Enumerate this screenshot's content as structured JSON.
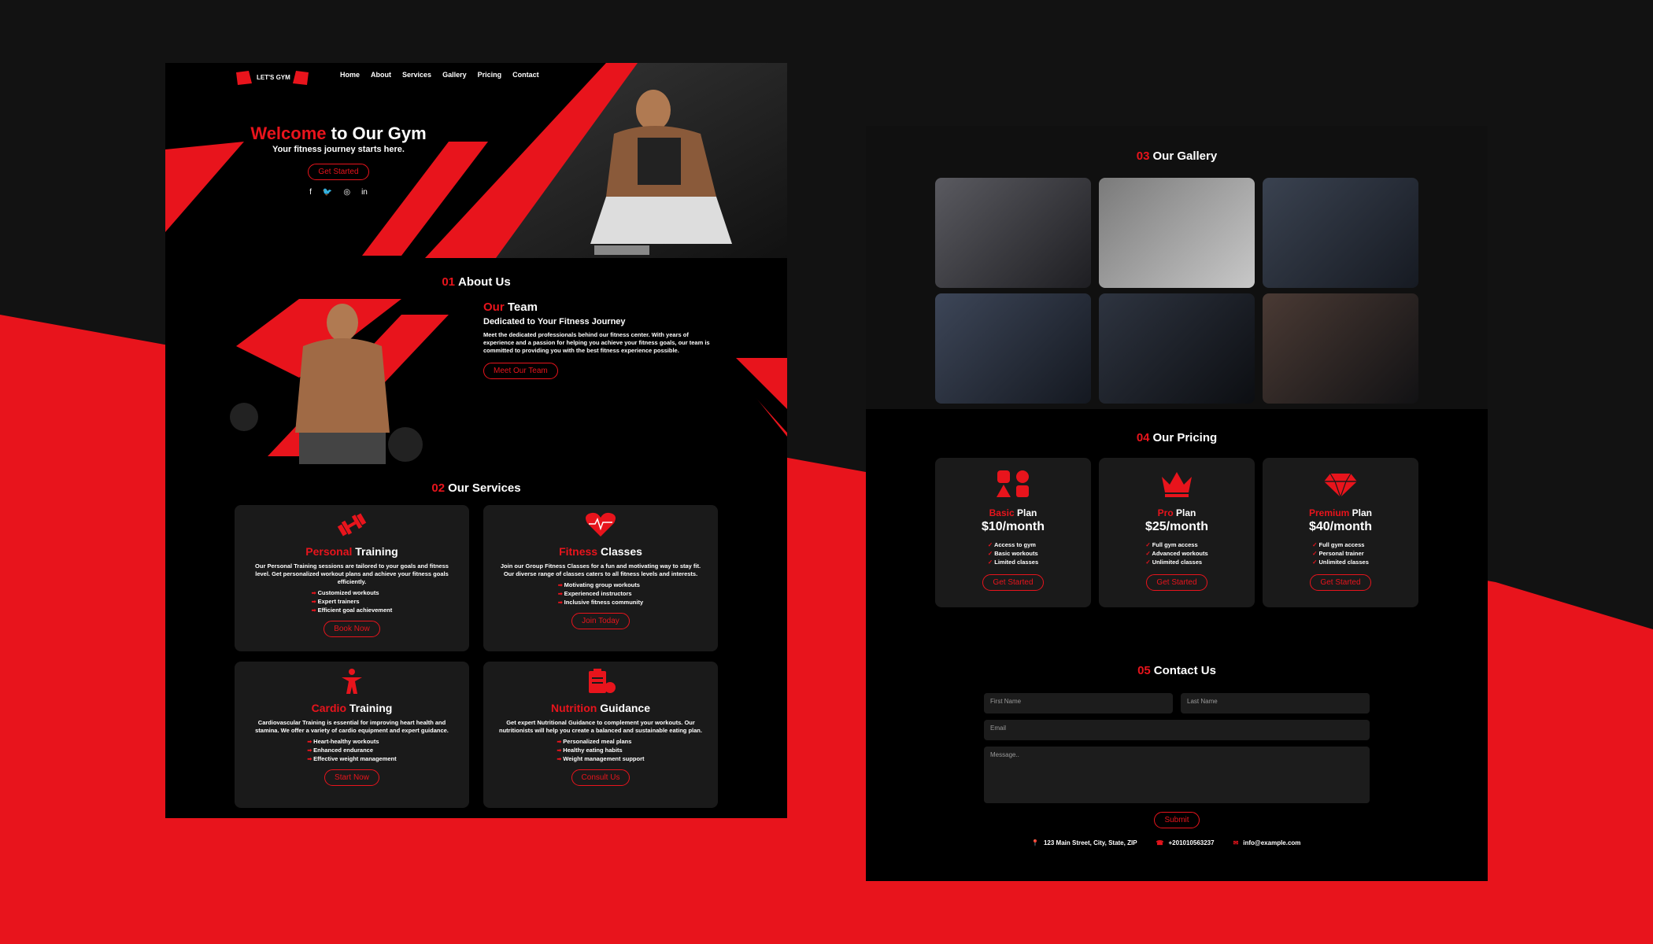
{
  "nav": {
    "logo_text": "LET'S GYM",
    "items": [
      "Home",
      "About",
      "Services",
      "Gallery",
      "Pricing",
      "Contact"
    ]
  },
  "hero": {
    "title_red": "Welcome",
    "title_rest": "to Our Gym",
    "subtitle": "Your fitness journey starts here.",
    "button": "Get Started",
    "socials": [
      "facebook-icon",
      "twitter-icon",
      "instagram-icon",
      "linkedin-icon"
    ]
  },
  "about": {
    "num": "01",
    "title": "About Us",
    "heading_red": "Our",
    "heading_rest": "Team",
    "subheading": "Dedicated to Your Fitness Journey",
    "text": "Meet the dedicated professionals behind our fitness center. With years of experience and a passion for helping you achieve your fitness goals, our team is committed to providing you with the best fitness experience possible.",
    "button": "Meet Our Team"
  },
  "services": {
    "num": "02",
    "title": "Our Services",
    "items": [
      {
        "title_red": "Personal",
        "title_rest": "Training",
        "icon": "dumbbell-icon",
        "desc": "Our Personal Training sessions are tailored to your goals and fitness level. Get personalized workout plans and achieve your fitness goals efficiently.",
        "list": [
          "Customized workouts",
          "Expert trainers",
          "Efficient goal achievement"
        ],
        "button": "Book Now"
      },
      {
        "title_red": "Fitness",
        "title_rest": "Classes",
        "icon": "heartbeat-icon",
        "desc": "Join our Group Fitness Classes for a fun and motivating way to stay fit. Our diverse range of classes caters to all fitness levels and interests.",
        "list": [
          "Motivating group workouts",
          "Experienced instructors",
          "Inclusive fitness community"
        ],
        "button": "Join Today"
      },
      {
        "title_red": "Cardio",
        "title_rest": "Training",
        "icon": "person-running-icon",
        "desc": "Cardiovascular Training is essential for improving heart health and stamina. We offer a variety of cardio equipment and expert guidance.",
        "list": [
          "Heart-healthy workouts",
          "Enhanced endurance",
          "Effective weight management"
        ],
        "button": "Start Now"
      },
      {
        "title_red": "Nutrition",
        "title_rest": "Guidance",
        "icon": "nutrition-icon",
        "desc": "Get expert Nutritional Guidance to complement your workouts. Our nutritionists will help you create a balanced and sustainable eating plan.",
        "list": [
          "Personalized meal plans",
          "Healthy eating habits",
          "Weight management support"
        ],
        "button": "Consult Us"
      }
    ]
  },
  "gallery": {
    "num": "03",
    "title": "Our Gallery"
  },
  "pricing": {
    "num": "04",
    "title": "Our Pricing",
    "plans": [
      {
        "name_red": "Basic",
        "name_rest": "Plan",
        "price": "$10/month",
        "icon": "shapes-icon",
        "features": [
          "Access to gym",
          "Basic workouts",
          "Limited classes"
        ],
        "button": "Get Started"
      },
      {
        "name_red": "Pro",
        "name_rest": "Plan",
        "price": "$25/month",
        "icon": "crown-icon",
        "features": [
          "Full gym access",
          "Advanced workouts",
          "Unlimited classes"
        ],
        "button": "Get Started"
      },
      {
        "name_red": "Premium",
        "name_rest": "Plan",
        "price": "$40/month",
        "icon": "diamond-icon",
        "features": [
          "Full gym access",
          "Personal trainer",
          "Unlimited classes"
        ],
        "button": "Get Started"
      }
    ]
  },
  "contact": {
    "num": "05",
    "title": "Contact Us",
    "first_name": "First Name",
    "last_name": "Last Name",
    "email": "Email",
    "message": "Message..",
    "submit": "Submit",
    "address": "123 Main Street, City, State, ZIP",
    "phone": "+201010563237",
    "mail": "info@example.com"
  },
  "colors": {
    "accent": "#e8141c",
    "panel_bg": "#000000",
    "card_bg": "#1a1a1a",
    "page_bg": "#121212"
  }
}
